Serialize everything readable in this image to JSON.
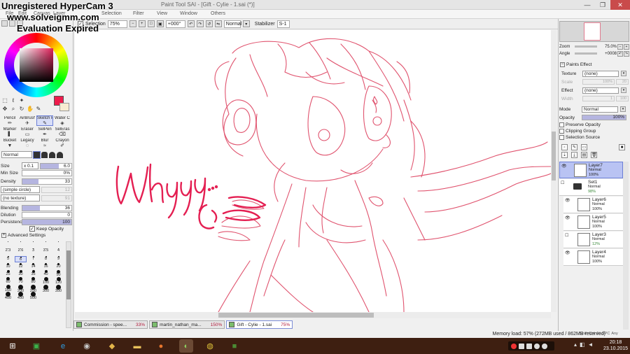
{
  "watermark": {
    "line1": "Unregistered HyperCam 3",
    "line2": "www.solveigmm.com",
    "line3": "Evaluation Expired"
  },
  "window": {
    "title": "Paint Tool SAI - [Gift - Cylie - 1.sai (*)]"
  },
  "menu": [
    "File",
    "Edit",
    "Canvas",
    "Layer",
    "Selection",
    "Filter",
    "View",
    "Window",
    "Others"
  ],
  "toolbar": {
    "selection_label": "Selection",
    "zoom": "75%",
    "angle": "+000°",
    "mode": "Normal",
    "stabilizer_label": "Stabilizer",
    "stabilizer_value": "S-1"
  },
  "tools": {
    "brushes": [
      {
        "name": "Pencil",
        "selected": false
      },
      {
        "name": "AirBrush",
        "selected": false
      },
      {
        "name": "Sketch P",
        "selected": true
      },
      {
        "name": "Water Color",
        "selected": false
      },
      {
        "name": "Marker",
        "selected": false
      },
      {
        "name": "Eraser",
        "selected": false
      },
      {
        "name": "SelPen",
        "selected": false
      },
      {
        "name": "SelEras",
        "selected": false
      },
      {
        "name": "Bucket",
        "selected": false
      },
      {
        "name": "Legacy",
        "selected": false
      },
      {
        "name": "Blur",
        "selected": false
      },
      {
        "name": "Crayon",
        "selected": false
      }
    ],
    "blend_mode": "Normal",
    "colors": {
      "foreground": "#ee1b4c",
      "background": "#f7ecd2"
    }
  },
  "params": {
    "size_label": "Size",
    "size_mult": "x 0.1",
    "size_value": "6.0",
    "min_size_label": "Min Size",
    "min_size_value": "0%",
    "density_label": "Density",
    "density_value": "33",
    "shape": "(simple circle)",
    "shape_value": "12",
    "texture": "(no texture)",
    "texture_value": "91",
    "blending_label": "Blending",
    "blending_value": "36",
    "dilution_label": "Dilution",
    "dilution_value": "0",
    "persistence_label": "Persistence",
    "persistence_value": "100",
    "keep_opacity_label": "Keep Opacity",
    "advanced_label": "Advanced Settings"
  },
  "sizes": [
    {
      "label": "",
      "dot": 1
    },
    {
      "label": "",
      "dot": 1
    },
    {
      "label": "",
      "dot": 1
    },
    {
      "label": "",
      "dot": 1
    },
    {
      "label": "",
      "dot": 1
    },
    {
      "label": "2.3",
      "dot": 1
    },
    {
      "label": "2.6",
      "dot": 1
    },
    {
      "label": "3",
      "dot": 1
    },
    {
      "label": "3.5",
      "dot": 1
    },
    {
      "label": "4",
      "dot": 1
    },
    {
      "label": "5",
      "dot": 2
    },
    {
      "label": "6",
      "dot": 2,
      "selected": true
    },
    {
      "label": "7",
      "dot": 2
    },
    {
      "label": "8",
      "dot": 2
    },
    {
      "label": "9",
      "dot": 2
    },
    {
      "label": "10",
      "dot": 3
    },
    {
      "label": "12",
      "dot": 3
    },
    {
      "label": "14",
      "dot": 3
    },
    {
      "label": "16",
      "dot": 3
    },
    {
      "label": "20",
      "dot": 3
    },
    {
      "label": "25",
      "dot": 4
    },
    {
      "label": "30",
      "dot": 4
    },
    {
      "label": "35",
      "dot": 4
    },
    {
      "label": "40",
      "dot": 4
    },
    {
      "label": "50",
      "dot": 5
    },
    {
      "label": "60",
      "dot": 5
    },
    {
      "label": "70",
      "dot": 5
    },
    {
      "label": "80",
      "dot": 5
    },
    {
      "label": "100",
      "dot": 6
    },
    {
      "label": "120",
      "dot": 6
    },
    {
      "label": "160",
      "dot": 6
    },
    {
      "label": "200",
      "dot": 7
    },
    {
      "label": "250",
      "dot": 7
    },
    {
      "label": "300",
      "dot": 7
    },
    {
      "label": "350",
      "dot": 7
    },
    {
      "label": "400",
      "dot": 7
    },
    {
      "label": "450",
      "dot": 7
    },
    {
      "label": "500",
      "dot": 7
    }
  ],
  "canvas": {
    "handwritten_text": "Whyyy...",
    "stroke_color": "#e0536e",
    "text_color": "#e41f52"
  },
  "doc_tabs": [
    {
      "name": "Commission - spee...",
      "zoom": "33%",
      "active": false
    },
    {
      "name": "martin_nathan_ma...",
      "zoom": "150%",
      "active": false
    },
    {
      "name": "Gift - Cylie - 1.sai",
      "zoom": "75%",
      "active": true
    }
  ],
  "status": {
    "memory": "Memory load: 57% (272MB used / 862MB reserved)",
    "keys": [
      "Shift",
      "Ctrl",
      "Alt",
      "SPC",
      "Any"
    ]
  },
  "navigator": {
    "zoom_label": "Zoom",
    "zoom_value": "75.0%",
    "angle_label": "Angle",
    "angle_value": "+0008"
  },
  "paints_effect": {
    "title": "Paints Effect",
    "texture_label": "Texture",
    "texture_value": "(none)",
    "scale_label": "Scale",
    "scale_value": "100%",
    "scale_num": "20",
    "effect_label": "Effect",
    "effect_value": "(none)",
    "width_label": "Width",
    "width_value": "1",
    "width_num": "100"
  },
  "layer_props": {
    "mode_label": "Mode",
    "mode_value": "Normal",
    "opacity_label": "Opacity",
    "opacity_value": "100%",
    "preserve_opacity": "Preserve Opacity",
    "clipping_group": "Clipping Group",
    "selection_source": "Selection Source"
  },
  "layers": [
    {
      "name": "Layer7",
      "mode": "Normal",
      "opacity": "100%",
      "selected": true,
      "folder": false,
      "visible": true
    },
    {
      "name": "Set1",
      "mode": "Normal",
      "opacity": "98%",
      "selected": false,
      "folder": true,
      "visible": false
    },
    {
      "name": "Layer6",
      "mode": "Normal",
      "opacity": "100%",
      "selected": false,
      "folder": false,
      "visible": true
    },
    {
      "name": "Layer5",
      "mode": "Normal",
      "opacity": "100%",
      "selected": false,
      "folder": false,
      "visible": true
    },
    {
      "name": "Layer3",
      "mode": "Normal",
      "opacity": "12%",
      "selected": false,
      "folder": false,
      "visible": false
    },
    {
      "name": "Layer4",
      "mode": "Normal",
      "opacity": "100%",
      "selected": false,
      "folder": false,
      "visible": true
    }
  ],
  "taskbar": {
    "apps": [
      {
        "name": "windows-start-icon",
        "glyph": "⊞",
        "color": "#ffffff",
        "bg": "transparent"
      },
      {
        "name": "store-icon",
        "glyph": "▣",
        "color": "#3bb34a",
        "bg": "transparent"
      },
      {
        "name": "internet-explorer-icon",
        "glyph": "e",
        "color": "#2ea0e6",
        "bg": "transparent"
      },
      {
        "name": "media-player-icon",
        "glyph": "◉",
        "color": "#c8c8c8",
        "bg": "transparent"
      },
      {
        "name": "game-icon",
        "glyph": "◆",
        "color": "#e3b54a",
        "bg": "transparent"
      },
      {
        "name": "file-explorer-icon",
        "glyph": "▬",
        "color": "#e9c25b",
        "bg": "transparent"
      },
      {
        "name": "firefox-icon",
        "glyph": "●",
        "color": "#e8762d",
        "bg": "transparent"
      },
      {
        "name": "paint-tool-sai-icon",
        "glyph": "◐",
        "color": "#8dcf5f",
        "bg": "#6b4a35"
      },
      {
        "name": "chrome-icon",
        "glyph": "◍",
        "color": "#e0c43a",
        "bg": "transparent"
      },
      {
        "name": "minecraft-icon",
        "glyph": "■",
        "color": "#4b8b34",
        "bg": "transparent"
      }
    ],
    "time": "20:18",
    "date": "23.10.2015"
  }
}
